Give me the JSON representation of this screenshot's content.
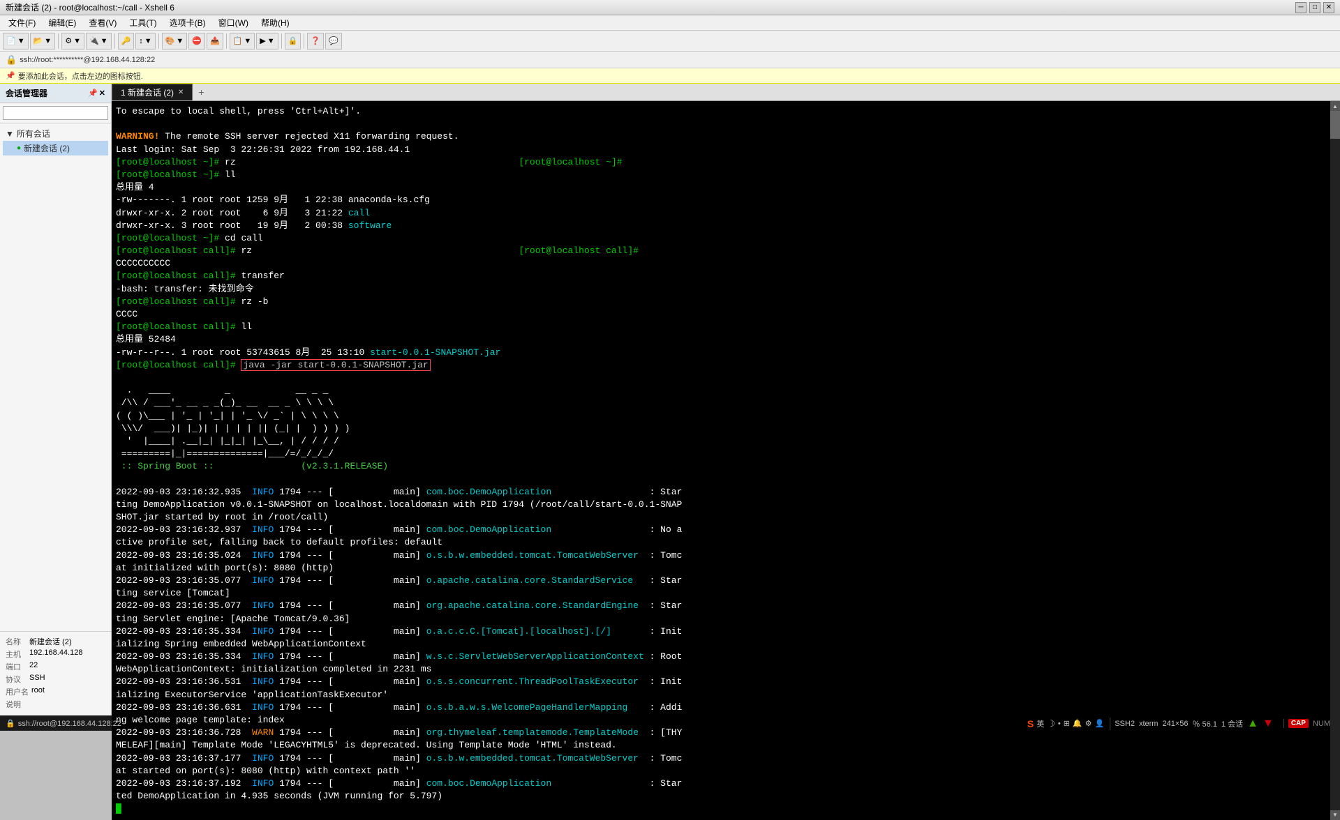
{
  "window": {
    "title": "新建会话 (2) - root@localhost:~/call - Xshell 6",
    "controls": [
      "minimize",
      "maximize",
      "close"
    ]
  },
  "menubar": {
    "items": [
      "文件(F)",
      "编辑(E)",
      "查看(V)",
      "工具(T)",
      "选项卡(B)",
      "窗口(W)",
      "帮助(H)"
    ]
  },
  "address_bar": {
    "icon": "🔒",
    "text": "ssh://root:**********@192.168.44.128:22"
  },
  "notify_bar": {
    "icon": "📌",
    "text": "要添加此会话，点击左边的图标按钮."
  },
  "sidebar": {
    "header": "会话管理器",
    "search_placeholder": "",
    "tree": {
      "all_sessions_label": "所有会话",
      "sessions": [
        {
          "name": "新建会话 (2)",
          "active": true
        }
      ]
    }
  },
  "info_panel": {
    "rows": [
      {
        "label": "名称",
        "value": "新建会话 (2)"
      },
      {
        "label": "主机",
        "value": "192.168.44.128"
      },
      {
        "label": "端口",
        "value": "22"
      },
      {
        "label": "协议",
        "value": "SSH"
      },
      {
        "label": "用户名",
        "value": "root"
      },
      {
        "label": "说明",
        "value": ""
      }
    ]
  },
  "tabs": [
    {
      "label": "1 新建会话 (2)",
      "active": true
    }
  ],
  "terminal": {
    "lines": [
      "To escape to local shell, press 'Ctrl+Alt+]'.",
      "",
      "WARNING! The remote SSH server rejected X11 forwarding request.",
      "Last login: Sat Sep  3 22:26:31 2022 from 192.168.44.1",
      "[root@localhost ~]# rz                                                    [root@localhost ~]#",
      "[root@localhost ~]# ll",
      "总用量 4",
      "-rw-------. 1 root root 1259 9月   1 22:38 anaconda-ks.cfg",
      "drwxr-xr-x. 2 root root    6 9月   3 21:22 call",
      "drwxr-xr-x. 3 root root   19 9月   2 00:38 software",
      "[root@localhost ~]# cd call",
      "[root@localhost call]# rz                                                 [root@localhost call]#",
      "CCCCCCCCCC",
      "[root@localhost call]# transfer",
      "-bash: transfer: 未找到命令",
      "[root@localhost call]# rz -b",
      "CCCC",
      "[root@localhost call]# ll",
      "总用量 52484",
      "-rw-r--r--. 1 root root 53743615 8月  25 13:10 start-0.0.1-SNAPSHOT.jar",
      "[root@localhost call]# java -jar start-0.0.1-SNAPSHOT.jar",
      "",
      "  .   ____          _            __ _ _",
      " /\\\\ / ___'_ __ _ _(_)_ __  __ _ \\ \\ \\ \\",
      "( ( )\\___ | '_ | '_| | '_ \\/ _` | \\ \\ \\ \\",
      " \\\\/  ___)| |_)| | | | | || (_| |  ) ) ) )",
      "  '  |____| .__|_| |_|_| |_\\__, | / / / /",
      " =========|_|==============|___/=/_/_/_/",
      " :: Spring Boot ::                (v2.3.1.RELEASE)",
      "",
      "2022-09-03 23:16:32.935  INFO 1794 --- [           main] com.boc.DemoApplication                  : Star",
      "ting DemoApplication v0.0.1-SNAPSHOT on localhost.localdomain with PID 1794 (/root/call/start-0.0.1-SNAP",
      "SHOT.jar started by root in /root/call)",
      "2022-09-03 23:16:32.937  INFO 1794 --- [           main] com.boc.DemoApplication                  : No a",
      "ctive profile set, falling back to default profiles: default",
      "2022-09-03 23:16:35.024  INFO 1794 --- [           main] o.s.b.w.embedded.tomcat.TomcatWebServer  : Tomc",
      "at initialized with port(s): 8080 (http)",
      "2022-09-03 23:16:35.077  INFO 1794 --- [           main] o.apache.catalina.core.StandardService   : Star",
      "ting service [Tomcat]",
      "2022-09-03 23:16:35.077  INFO 1794 --- [           main] org.apache.catalina.core.StandardEngine  : Star",
      "ting Servlet engine: [Apache Tomcat/9.0.36]",
      "2022-09-03 23:16:35.334  INFO 1794 --- [           main] o.a.c.c.C.[Tomcat].[localhost].[/]       : Init",
      "ializing Spring embedded WebApplicationContext",
      "2022-09-03 23:16:35.334  INFO 1794 --- [           main] w.s.c.ServletWebServerApplicationContext : Root",
      "WebApplicationContext: initialization completed in 2231 ms",
      "2022-09-03 23:16:36.531  INFO 1794 --- [           main] o.s.s.concurrent.ThreadPoolTaskExecutor  : Init",
      "ializing ExecutorService 'applicationTaskExecutor'",
      "2022-09-03 23:16:36.631  INFO 1794 --- [           main] o.s.b.a.w.s.WelcomePageHandlerMapping    : Addi",
      "ng welcome page template: index",
      "2022-09-03 23:16:36.728  WARN 1794 --- [           main] org.thymeleaf.templatemode.TemplateMode  : [THY",
      "MELEAF][main] Template Mode 'LEGACYHTML5' is deprecated. Using Template Mode 'HTML' instead.",
      "2022-09-03 23:16:37.177  INFO 1794 --- [           main] o.s.b.w.embedded.tomcat.TomcatWebServer  : Tomc",
      "at started on port(s): 8080 (http) with context path ''",
      "2022-09-03 23:16:37.192  INFO 1794 --- [           main] com.boc.DemoApplication                  : Star",
      "ted DemoApplication in 4.935 seconds (JVM running for 5.797)",
      "█"
    ]
  },
  "status_bar": {
    "left": {
      "icon": "ssh",
      "address": "ssh://root@192.168.44.128:22"
    },
    "right": {
      "tray_label": "英",
      "ssh2": "SSH2",
      "xterm": "xterm",
      "cols": "241×56",
      "col56": "％ 56.1",
      "sessions": "1 会话",
      "cap_badge": "CAP",
      "num_badge": "NUM"
    }
  }
}
